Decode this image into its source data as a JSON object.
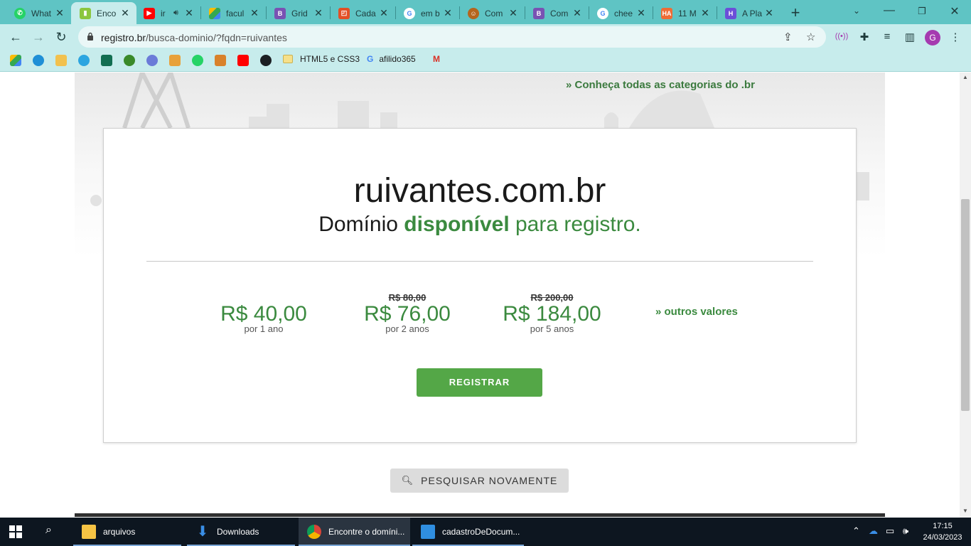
{
  "browser": {
    "tabs": [
      {
        "label": "What",
        "icon": "whatsapp-icon",
        "color": "#25d366"
      },
      {
        "label": "Enco",
        "icon": "registro-br-icon",
        "color": "#8cc63f",
        "active": true
      },
      {
        "label": "ir",
        "icon": "youtube-icon",
        "color": "#ff0000"
      },
      {
        "label": "facul",
        "icon": "google-drive-icon",
        "color": "#34a853"
      },
      {
        "label": "Grid",
        "icon": "bootstrap-icon",
        "color": "#7952b3"
      },
      {
        "label": "Cada",
        "icon": "html-icon",
        "color": "#e34f26"
      },
      {
        "label": "em b",
        "icon": "google-icon",
        "color": "#4285f4"
      },
      {
        "label": "Com",
        "icon": "avatar-icon",
        "color": "#b5651d"
      },
      {
        "label": "Com",
        "icon": "bootstrap-icon",
        "color": "#7952b3"
      },
      {
        "label": "chee",
        "icon": "google-icon",
        "color": "#4285f4"
      },
      {
        "label": "11 M",
        "icon": "ha-icon",
        "color": "#ef6c35"
      },
      {
        "label": "A Pla",
        "icon": "app-icon",
        "color": "#6b4fd8"
      }
    ],
    "url_domain": "registro.br",
    "url_path": "/busca-dominio/?fqdn=ruivantes",
    "profile_initial": "G",
    "bookmarks": {
      "folder_label": "HTML5 e CSS3",
      "google_label": "afilido365"
    }
  },
  "page": {
    "categories_link": "»  Conheça todas as categorias do .br",
    "domain": "ruivantes.com.br",
    "status_prefix": "Domínio",
    "status_available": "disponível",
    "status_suffix": "para registro.",
    "prices": [
      {
        "old": "",
        "value": "R$ 40,00",
        "period": "por 1 ano"
      },
      {
        "old": "R$ 80,00",
        "value": "R$ 76,00",
        "period": "por 2 anos"
      },
      {
        "old": "R$ 200,00",
        "value": "R$ 184,00",
        "period": "por 5 anos"
      }
    ],
    "other_values": "» outros valores",
    "register_button": "REGISTRAR",
    "search_again_button": "PESQUISAR NOVAMENTE",
    "accent_color": "#3b8a3f"
  },
  "taskbar": {
    "apps": [
      {
        "label": "arquivos",
        "icon": "folder-icon"
      },
      {
        "label": "Downloads",
        "icon": "download-icon"
      },
      {
        "label": "Encontre o domíni...",
        "icon": "chrome-icon"
      },
      {
        "label": "cadastroDeDocum...",
        "icon": "vscode-icon"
      }
    ],
    "time": "17:15",
    "date": "24/03/2023"
  }
}
